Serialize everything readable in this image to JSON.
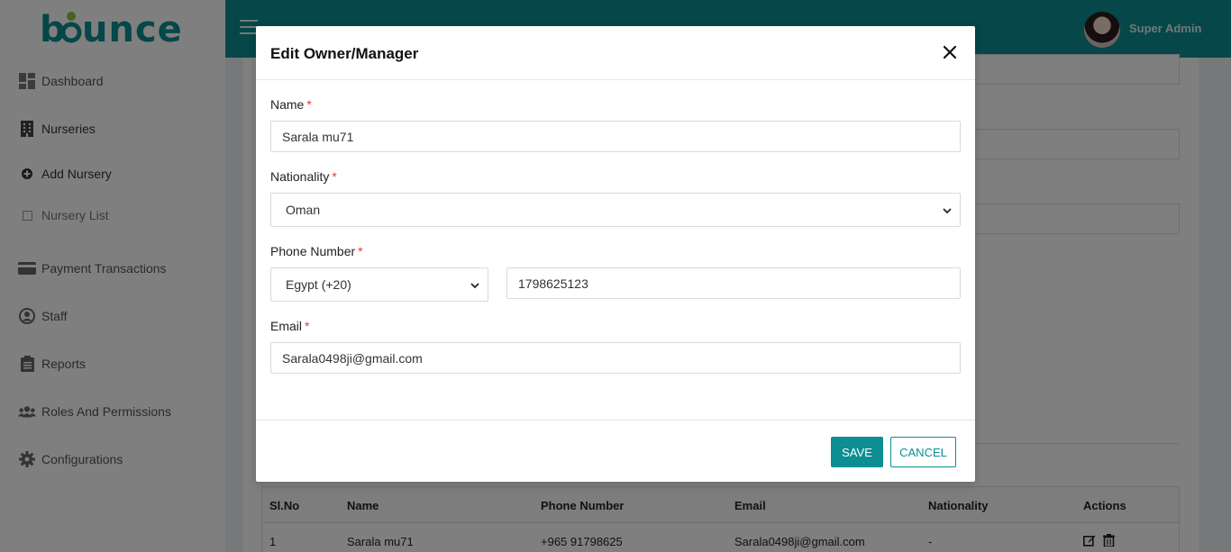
{
  "app": {
    "logo_text": "bounce",
    "accent_color": "#0c8e92"
  },
  "header": {
    "user_name": "Super Admin"
  },
  "sidebar": {
    "items": [
      {
        "label": "Dashboard",
        "icon": "dashboard-icon"
      },
      {
        "label": "Nurseries",
        "icon": "building-icon"
      },
      {
        "label": "Add Nursery",
        "icon": "plus-circle-icon"
      },
      {
        "label": "Nursery List",
        "icon": "square-icon"
      },
      {
        "label": "Payment Transactions",
        "icon": "credit-card-icon"
      },
      {
        "label": "Staff",
        "icon": "user-circle-icon"
      },
      {
        "label": "Reports",
        "icon": "clipboard-icon"
      },
      {
        "label": "Roles And Permissions",
        "icon": "users-icon"
      },
      {
        "label": "Configurations",
        "icon": "gear-icon"
      }
    ]
  },
  "table": {
    "headers": [
      "Sl.No",
      "Name",
      "Phone Number",
      "Email",
      "Nationality",
      "Actions"
    ],
    "rows": [
      [
        "1",
        "Sarala mu71",
        "+965 91798625",
        "Sarala0498ji@gmail.com",
        "-"
      ]
    ]
  },
  "modal": {
    "title": "Edit Owner/Manager",
    "name_label": "Name",
    "name_value": "Sarala mu71",
    "nationality_label": "Nationality",
    "nationality_value": "Oman",
    "phone_label": "Phone Number",
    "country_code_value": "Egypt (+20)",
    "phone_value": "1798625123",
    "email_label": "Email",
    "email_value": "Sarala0498ji@gmail.com",
    "required_mark": "*",
    "save_label": "SAVE",
    "cancel_label": "CANCEL"
  }
}
